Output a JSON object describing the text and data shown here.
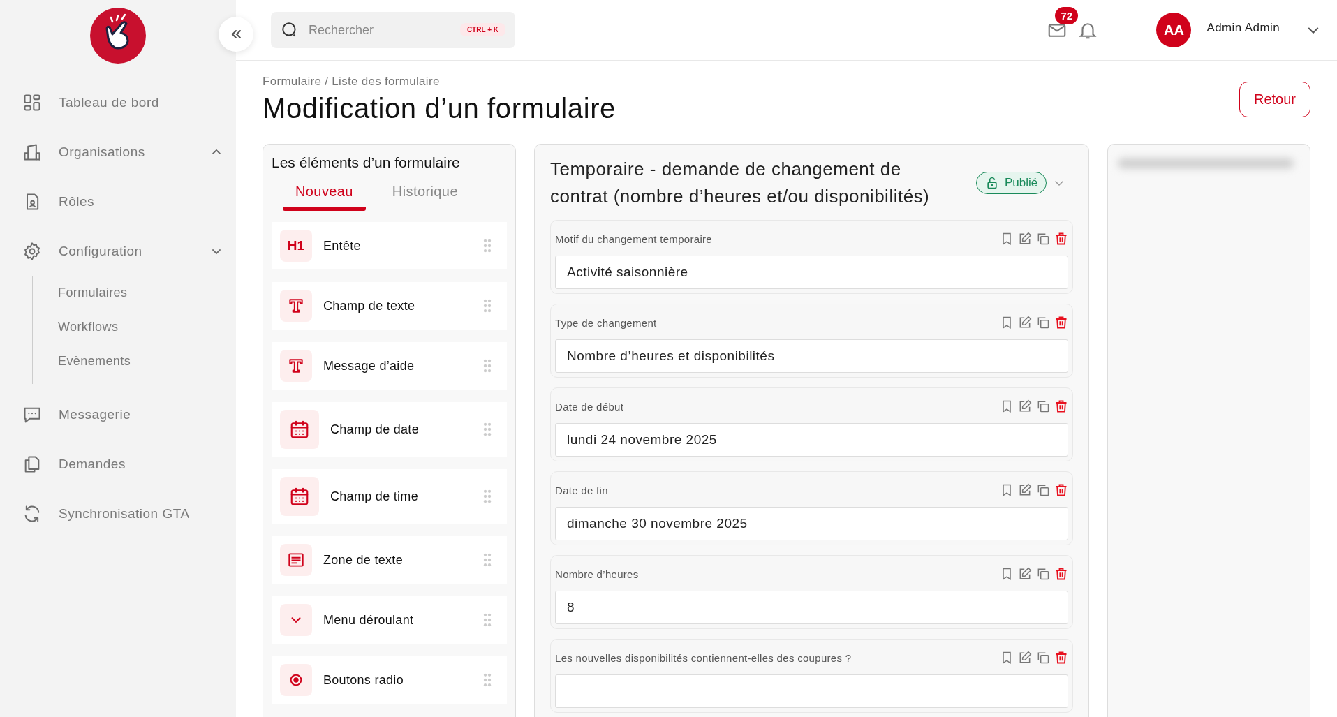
{
  "sidebar": {
    "items": [
      {
        "label": "Tableau de bord"
      },
      {
        "label": "Organisations",
        "expanded": true
      },
      {
        "label": "Rôles"
      },
      {
        "label": "Configuration",
        "expanded": false,
        "children": [
          {
            "label": "Formulaires"
          },
          {
            "label": "Workflows"
          },
          {
            "label": "Evènements"
          }
        ]
      },
      {
        "label": "Messagerie"
      },
      {
        "label": "Demandes"
      },
      {
        "label": "Synchronisation GTA"
      }
    ]
  },
  "search": {
    "placeholder": "Rechercher",
    "shortcut": "CTRL + K"
  },
  "header": {
    "mail_count": "72",
    "user": {
      "initials": "AA",
      "name": "Admin Admin"
    }
  },
  "breadcrumb": "Formulaire / Liste des formulaire",
  "title": "Modification d’un formulaire",
  "back_button": "Retour",
  "elements_panel": {
    "title": "Les éléments d’un formulaire",
    "tabs": [
      {
        "label": "Nouveau",
        "selected": true
      },
      {
        "label": "Historique",
        "selected": false
      }
    ],
    "items": [
      {
        "label": "Entête",
        "kind": "heading",
        "icon_text": "H1"
      },
      {
        "label": "Champ de texte",
        "kind": "text"
      },
      {
        "label": "Message d’aide",
        "kind": "text"
      },
      {
        "label": "Champ de date",
        "kind": "date"
      },
      {
        "label": "Champ de time",
        "kind": "date"
      },
      {
        "label": "Zone de texte",
        "kind": "textarea"
      },
      {
        "label": "Menu déroulant",
        "kind": "select"
      },
      {
        "label": "Boutons radio",
        "kind": "radio"
      }
    ]
  },
  "form": {
    "title": "Temporaire - demande de changement de contrat (nombre d’heures et/ou disponibilités)",
    "status": "Publié",
    "fields": [
      {
        "label": "Motif du changement temporaire",
        "value": "Activité saisonnière"
      },
      {
        "label": "Type de changement",
        "value": "Nombre d’heures et disponibilités"
      },
      {
        "label": "Date de début",
        "value": "lundi 24 novembre 2025"
      },
      {
        "label": "Date de fin",
        "value": "dimanche 30 novembre 2025"
      },
      {
        "label": "Nombre d’heures",
        "value": "8"
      },
      {
        "label": "Les nouvelles disponibilités contiennent-elles des coupures ?"
      }
    ]
  }
}
